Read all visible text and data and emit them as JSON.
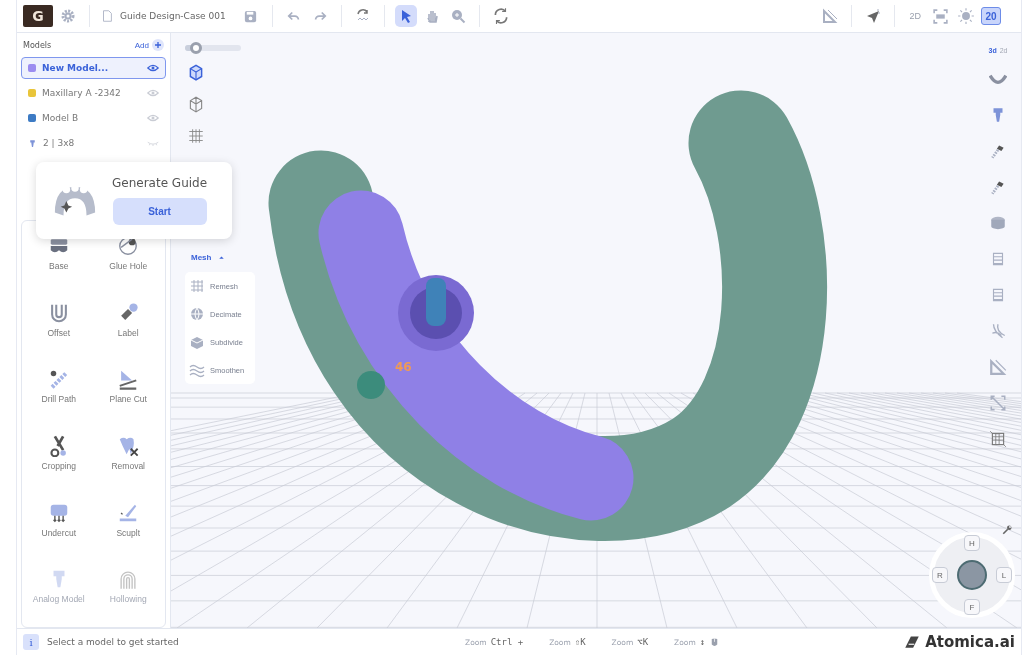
{
  "toolbar": {
    "logo_text": "G",
    "file_name": "Guide Design-Case 001",
    "modes": [
      {
        "selected": true
      },
      {
        "selected": false
      },
      {
        "selected": false
      }
    ],
    "view_2d": "2D",
    "layer_badge": {
      "text": "20",
      "selected": true
    }
  },
  "models": {
    "title": "Models",
    "add": "Add",
    "items": [
      {
        "name": "New Model...",
        "color": "#9b8cf0",
        "selected": true,
        "visible": true,
        "kind": "model"
      },
      {
        "name": "Maxillary A -2342",
        "color": "#e9c53a",
        "selected": false,
        "visible": true,
        "kind": "model"
      },
      {
        "name": "Model B",
        "color": "#3d7bc4",
        "selected": false,
        "visible": true,
        "kind": "model"
      },
      {
        "name": "2 | 3x8",
        "color": "#7d93d8",
        "selected": false,
        "visible": false,
        "kind": "implant"
      }
    ]
  },
  "popup": {
    "title": "Generate Guide",
    "button": "Start"
  },
  "tools": [
    {
      "label": "Base",
      "disabled": false
    },
    {
      "label": "Glue Hole",
      "disabled": false
    },
    {
      "label": "Offset",
      "disabled": false
    },
    {
      "label": "Label",
      "disabled": false
    },
    {
      "label": "Drill Path",
      "disabled": false
    },
    {
      "label": "Plane Cut",
      "disabled": false
    },
    {
      "label": "Cropping",
      "disabled": false
    },
    {
      "label": "Removal",
      "disabled": false
    },
    {
      "label": "Undercut",
      "disabled": false
    },
    {
      "label": "Scuplt",
      "disabled": false
    },
    {
      "label": "Analog Model",
      "disabled": true
    },
    {
      "label": "Hollowing",
      "disabled": true
    }
  ],
  "view": {
    "opacity": {
      "level": 0.2
    },
    "display_modes": [
      {
        "selected": true
      },
      {
        "selected": false
      },
      {
        "selected": false
      }
    ],
    "mesh_toggle": "Mesh",
    "mesh_expanded": true,
    "mesh_tools": [
      "Remesh",
      "Decimate",
      "Subdivide",
      "Smoothen"
    ],
    "tooth_label": "46"
  },
  "dimension_toggle": [
    {
      "label": "3d",
      "selected": true
    },
    {
      "label": "2d",
      "selected": false
    }
  ],
  "navigator": [
    "H",
    "R",
    "L",
    "F"
  ],
  "status_bar": {
    "info": "i",
    "message": "Select a model to get started",
    "shortcuts": [
      {
        "label": "Zoom",
        "keys": "Ctrl +"
      },
      {
        "label": "Zoom",
        "keys": "⇧K"
      },
      {
        "label": "Zoom",
        "keys": "⌥K"
      },
      {
        "label": "Zoom",
        "keys": "↕"
      }
    ],
    "brand": "Atomica.ai"
  }
}
